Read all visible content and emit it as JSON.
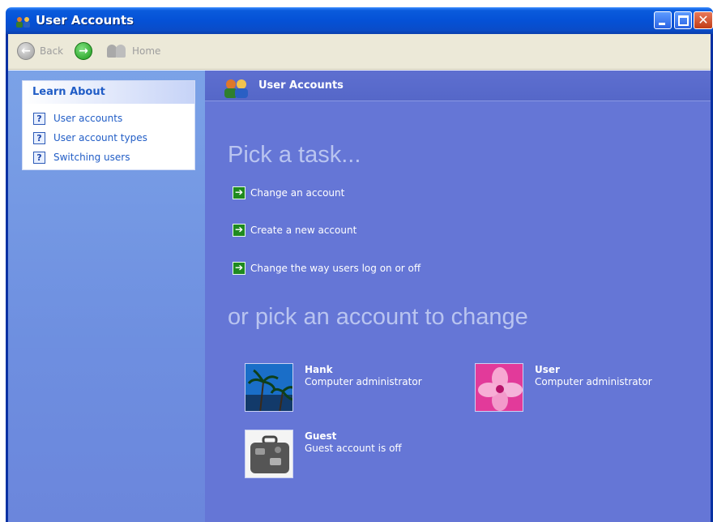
{
  "window": {
    "title": "User Accounts",
    "controls": [
      "minimize",
      "maximize",
      "close"
    ]
  },
  "toolbar": {
    "back_label": "Back",
    "home_label": "Home"
  },
  "learn_about": {
    "title": "Learn About",
    "items": [
      {
        "label": "User accounts",
        "icon": "help-icon"
      },
      {
        "label": "User account types",
        "icon": "help-icon"
      },
      {
        "label": "Switching users",
        "icon": "help-icon"
      }
    ]
  },
  "main": {
    "header_title": "User Accounts",
    "pick_task_heading": "Pick a task...",
    "tasks": [
      {
        "label": "Change an account",
        "icon": "green-arrow-icon"
      },
      {
        "label": "Create a new account",
        "icon": "green-arrow-icon"
      },
      {
        "label": "Change the way users log on or off",
        "icon": "green-arrow-icon"
      }
    ],
    "pick_account_heading": "or pick an account to change",
    "accounts": [
      {
        "name": "Hank",
        "type": "Computer administrator",
        "picture": "palm-trees"
      },
      {
        "name": "User",
        "type": "Computer administrator",
        "picture": "pink-flower"
      },
      {
        "name": "Guest",
        "type": "Guest account is off",
        "picture": "suitcase"
      }
    ]
  },
  "colors": {
    "title_bar": "#0551d6",
    "left_pane": "#7ba2e7",
    "main_bg": "#6576d6",
    "heading_text": "#b9c4f0",
    "link_blue": "#215dc6"
  }
}
